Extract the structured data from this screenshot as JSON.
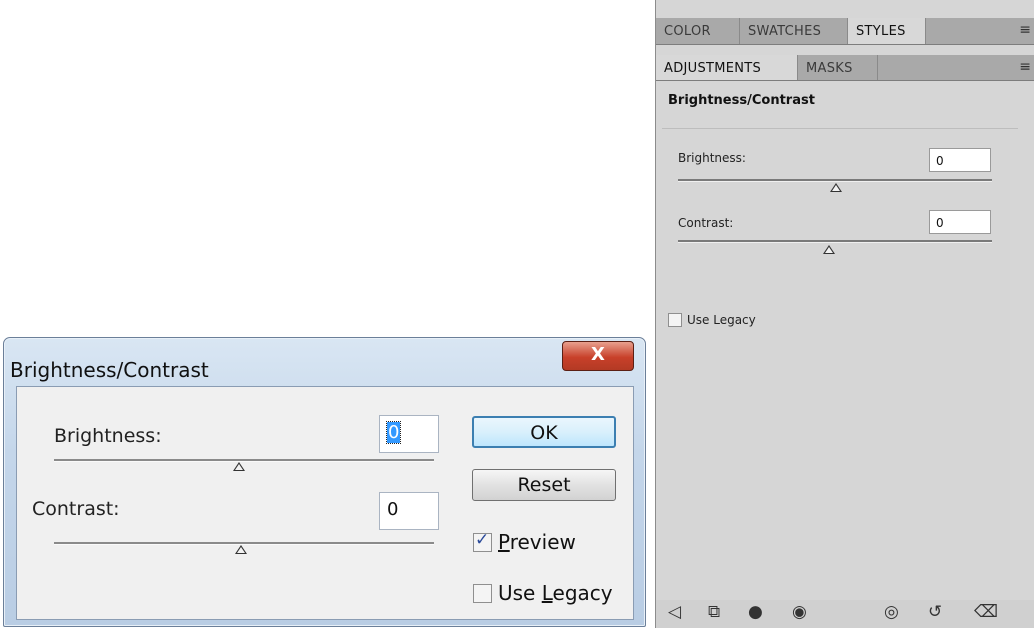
{
  "dialog": {
    "title": "Brightness/Contrast",
    "close_label": "X",
    "brightness": {
      "label": "Brightness:",
      "value": "0",
      "slider_level": 0.5
    },
    "contrast": {
      "label": "Contrast:",
      "value": "0",
      "slider_level": 0.5
    },
    "ok_label": "OK",
    "reset_label": "Reset",
    "preview": {
      "label_accel": "P",
      "label_rest": "review",
      "checked": true,
      "check_glyph": "✓"
    },
    "use_legacy": {
      "label_pre": "Use ",
      "label_accel": "L",
      "label_rest": "egacy",
      "checked": false
    }
  },
  "panel": {
    "tabs_top": [
      "COLOR",
      "SWATCHES",
      "STYLES"
    ],
    "tabs_second": [
      "ADJUSTMENTS",
      "MASKS"
    ],
    "menu_glyph": "≡",
    "heading": "Brightness/Contrast",
    "brightness": {
      "label": "Brightness:",
      "value": "0",
      "slider_level": 0.5
    },
    "contrast": {
      "label": "Contrast:",
      "value": "0",
      "slider_level": 0.5
    },
    "use_legacy_label": "Use Legacy",
    "bottom_icons": [
      "return-to-list-icon",
      "expand-view-icon",
      "clip-to-layer-icon",
      "visibility-eye-icon",
      "view-previous-state-icon",
      "reset-icon",
      "delete-icon"
    ]
  }
}
